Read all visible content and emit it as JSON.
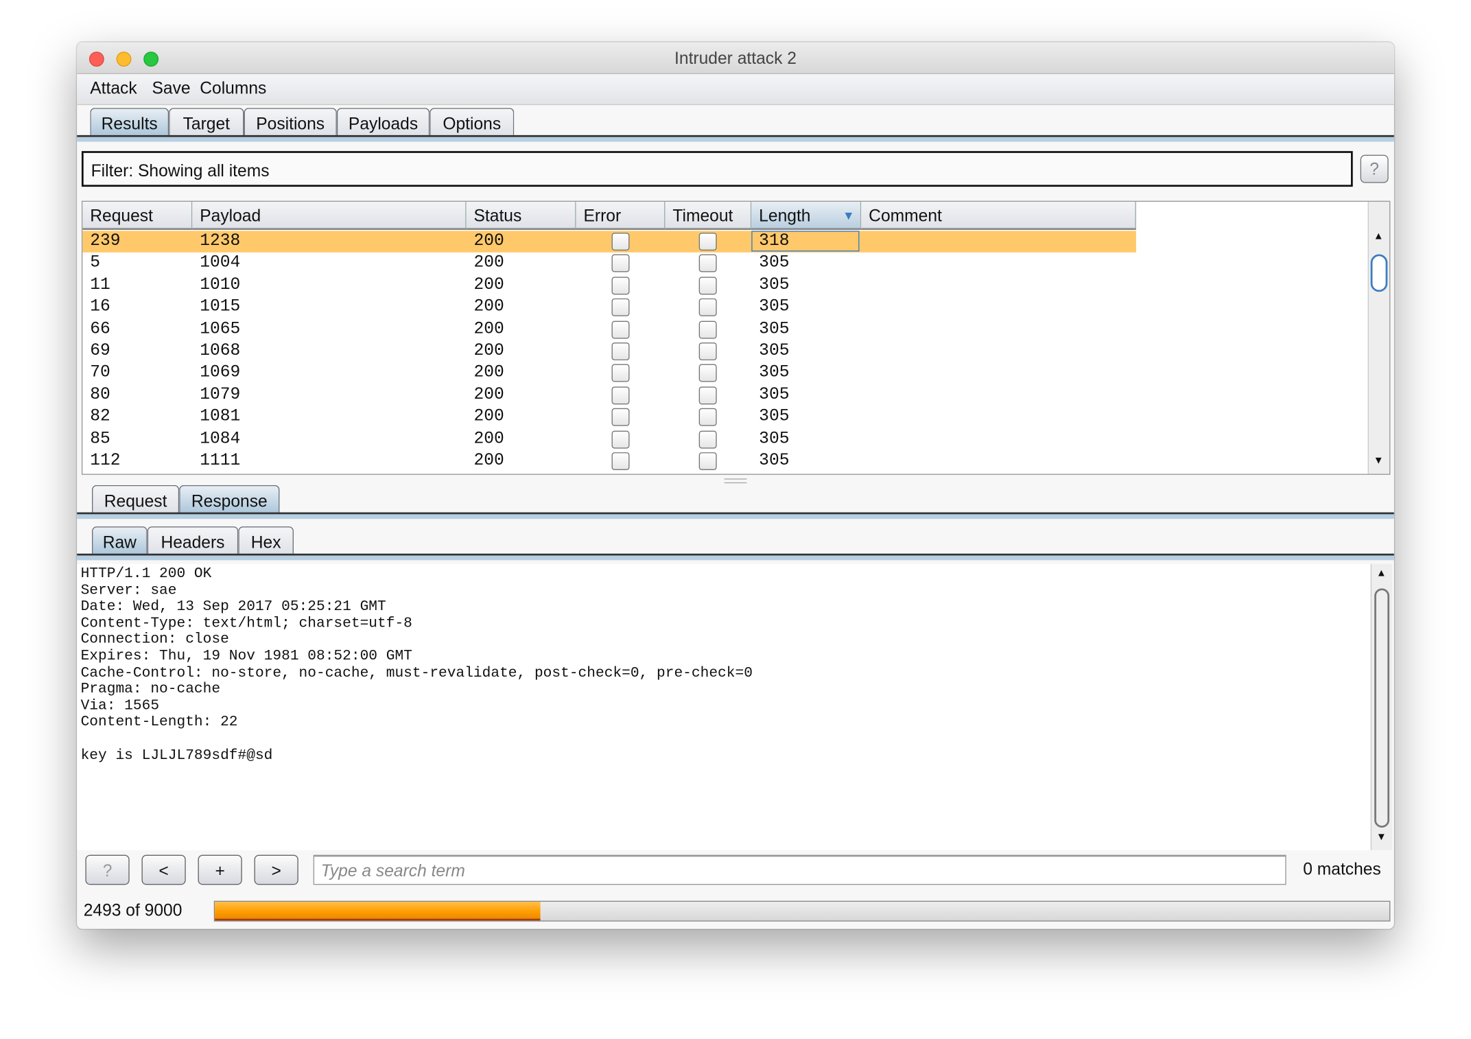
{
  "window": {
    "title": "Intruder attack 2"
  },
  "menu": [
    "Attack",
    "Save",
    "Columns"
  ],
  "tabs": [
    "Results",
    "Target",
    "Positions",
    "Payloads",
    "Options"
  ],
  "active_tab": "Results",
  "filter": {
    "text": "Filter: Showing all items",
    "help": "?"
  },
  "table": {
    "columns": [
      "Request",
      "Payload",
      "Status",
      "Error",
      "Timeout",
      "Length",
      "Comment"
    ],
    "sorted_column": "Length",
    "sort_indicator": "▼",
    "rows": [
      {
        "request": "239",
        "payload": "1238",
        "status": "200",
        "error": false,
        "timeout": false,
        "length": "318",
        "comment": "",
        "selected": true
      },
      {
        "request": "5",
        "payload": "1004",
        "status": "200",
        "error": false,
        "timeout": false,
        "length": "305",
        "comment": ""
      },
      {
        "request": "11",
        "payload": "1010",
        "status": "200",
        "error": false,
        "timeout": false,
        "length": "305",
        "comment": ""
      },
      {
        "request": "16",
        "payload": "1015",
        "status": "200",
        "error": false,
        "timeout": false,
        "length": "305",
        "comment": ""
      },
      {
        "request": "66",
        "payload": "1065",
        "status": "200",
        "error": false,
        "timeout": false,
        "length": "305",
        "comment": ""
      },
      {
        "request": "69",
        "payload": "1068",
        "status": "200",
        "error": false,
        "timeout": false,
        "length": "305",
        "comment": ""
      },
      {
        "request": "70",
        "payload": "1069",
        "status": "200",
        "error": false,
        "timeout": false,
        "length": "305",
        "comment": ""
      },
      {
        "request": "80",
        "payload": "1079",
        "status": "200",
        "error": false,
        "timeout": false,
        "length": "305",
        "comment": ""
      },
      {
        "request": "82",
        "payload": "1081",
        "status": "200",
        "error": false,
        "timeout": false,
        "length": "305",
        "comment": ""
      },
      {
        "request": "85",
        "payload": "1084",
        "status": "200",
        "error": false,
        "timeout": false,
        "length": "305",
        "comment": ""
      },
      {
        "request": "112",
        "payload": "1111",
        "status": "200",
        "error": false,
        "timeout": false,
        "length": "305",
        "comment": ""
      }
    ]
  },
  "message_tabs": [
    "Request",
    "Response"
  ],
  "active_message_tab": "Response",
  "view_tabs": [
    "Raw",
    "Headers",
    "Hex"
  ],
  "active_view_tab": "Raw",
  "response_text": "HTTP/1.1 200 OK\nServer: sae\nDate: Wed, 13 Sep 2017 05:25:21 GMT\nContent-Type: text/html; charset=utf-8\nConnection: close\nExpires: Thu, 19 Nov 1981 08:52:00 GMT\nCache-Control: no-store, no-cache, must-revalidate, post-check=0, pre-check=0\nPragma: no-cache\nVia: 1565\nContent-Length: 22\n\nkey is LJLJL789sdf#@sd",
  "search": {
    "help": "?",
    "prev": "<",
    "add": "+",
    "next": ">",
    "placeholder": "Type a search term",
    "value": "",
    "matches": "0 matches"
  },
  "progress": {
    "label": "2493 of 9000",
    "completed": 2493,
    "total": 9000,
    "fraction": 0.277
  },
  "colors": {
    "selected_row": "#ffc96b",
    "progress_fill": "#ff9c00",
    "active_tab": "#a7c4d9"
  }
}
